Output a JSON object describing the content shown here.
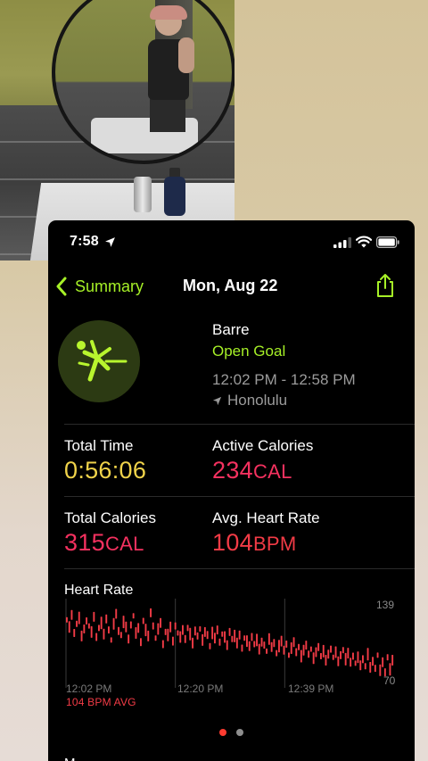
{
  "status_bar": {
    "time": "7:58"
  },
  "nav": {
    "back_label": "Summary",
    "title": "Mon, Aug 22"
  },
  "workout": {
    "name": "Barre",
    "goal": "Open Goal",
    "time_range": "12:02 PM - 12:58 PM",
    "location": "Honolulu"
  },
  "stats": {
    "total_time": {
      "label": "Total Time",
      "value": "0:56:06"
    },
    "active_calories": {
      "label": "Active Calories",
      "value": "234",
      "unit": "CAL"
    },
    "total_calories": {
      "label": "Total Calories",
      "value": "315",
      "unit": "CAL"
    },
    "avg_heart_rate": {
      "label": "Avg. Heart Rate",
      "value": "104",
      "unit": "BPM"
    }
  },
  "heart_rate": {
    "title": "Heart Rate",
    "max_label": "139",
    "min_label": "70",
    "x_labels": [
      "12:02 PM",
      "12:20 PM",
      "12:39 PM"
    ],
    "avg_label": "104 BPM AVG"
  },
  "chart_data": {
    "type": "bar",
    "title": "Heart Rate",
    "ylim": [
      70,
      139
    ],
    "x_tick_labels": [
      "12:02 PM",
      "12:20 PM",
      "12:39 PM"
    ],
    "grid": "vertical",
    "series": [
      {
        "values": [
          125,
          118,
          130,
          112,
          121,
          127,
          109,
          116,
          124,
          119,
          113,
          128,
          108,
          117,
          122,
          111,
          126,
          115,
          105,
          121,
          131,
          114,
          110,
          123,
          118,
          106,
          120,
          129,
          112,
          117,
          103,
          124,
          115,
          109,
          132,
          119,
          107,
          116,
          122,
          101,
          113,
          110,
          118,
          104,
          119,
          112,
          108,
          115,
          106,
          117,
          111,
          102,
          114,
          109,
          116,
          105,
          113,
          110,
          99,
          112,
          107,
          115,
          103,
          111,
          108,
          100,
          113,
          106,
          109,
          102,
          110,
          97,
          107,
          104,
          99,
          108,
          101,
          105,
          96,
          103,
          100,
          94,
          106,
          98,
          102,
          92,
          99,
          104,
          95,
          101,
          90,
          97,
          103,
          93,
          98,
          89,
          95,
          100,
          91,
          96,
          87,
          93,
          98,
          89,
          94,
          85,
          91,
          96,
          88,
          93,
          84,
          90,
          95,
          86,
          92,
          83,
          89,
          82,
          88,
          80,
          86,
          79,
          91,
          78,
          84,
          77,
          90,
          75,
          83,
          73,
          88,
          76,
          85
        ]
      }
    ]
  },
  "pagination": {
    "page": 1,
    "pages": 2
  },
  "bottom_label": "M",
  "colors": {
    "accent_green": "#a6f027",
    "time_yellow": "#f0d34a",
    "calorie_pink": "#f4315f",
    "heart_red": "#f23b46"
  },
  "icons": [
    "location-arrow-icon",
    "signal-icon",
    "wifi-icon",
    "battery-icon",
    "chevron-left-icon",
    "share-icon",
    "barre-workout-icon"
  ]
}
